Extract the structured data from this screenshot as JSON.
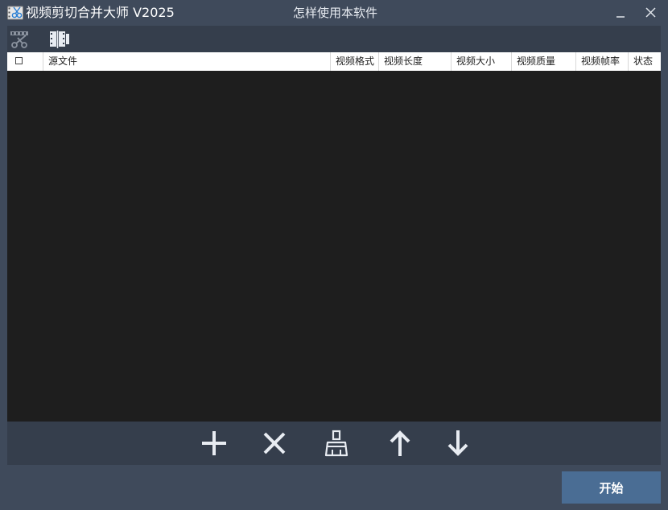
{
  "window": {
    "title": "视频剪切合并大师 V2025",
    "help_link": "怎样使用本软件",
    "icons": {
      "app": "scissors-film-icon",
      "minimize": "minimize-icon",
      "close": "close-icon"
    }
  },
  "toolbar": {
    "tools": [
      {
        "name": "cut-mode",
        "icon": "video-cut-icon",
        "state": "inactive"
      },
      {
        "name": "merge-mode",
        "icon": "video-merge-icon",
        "state": "active"
      }
    ]
  },
  "file_table": {
    "columns": [
      "源文件",
      "视频格式",
      "视频长度",
      "视频大小",
      "视频质量",
      "视频帧率",
      "状态"
    ],
    "select_all_checked": false,
    "rows": []
  },
  "actions": [
    {
      "name": "add",
      "icon": "plus-icon"
    },
    {
      "name": "remove",
      "icon": "x-icon"
    },
    {
      "name": "clear",
      "icon": "broom-icon"
    },
    {
      "name": "move-up",
      "icon": "arrow-up-icon"
    },
    {
      "name": "move-down",
      "icon": "arrow-down-icon"
    }
  ],
  "start_button": {
    "label": "开始",
    "color": "#4a6d94"
  },
  "colors": {
    "window_bg": "#3f4a5b",
    "panel_bg": "#353e4c",
    "list_bg": "#1e1e1e",
    "header_bg": "#ffffff"
  }
}
